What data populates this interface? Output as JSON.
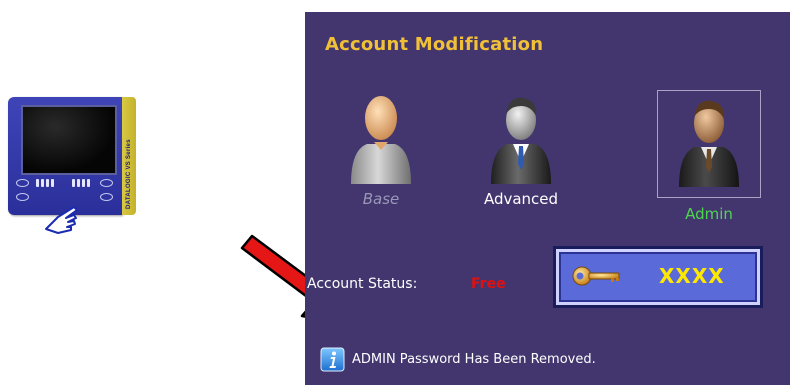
{
  "device": {
    "icon": "scanner-device-icon",
    "brand_text": "DATALOGIC VS Series",
    "hand_icon": "pointing-hand-icon"
  },
  "arrow": {
    "icon": "red-arrow-icon",
    "color": "#e41616"
  },
  "panel": {
    "title": "Account Modification",
    "background": "#43366f",
    "accounts": [
      {
        "label": "Base",
        "icon": "user-base-icon",
        "state": "disabled"
      },
      {
        "label": "Advanced",
        "icon": "user-advanced-icon",
        "state": "normal"
      },
      {
        "label": "Admin",
        "icon": "user-admin-icon",
        "state": "selected"
      }
    ],
    "status": {
      "label": "Account Status:",
      "value": "Free",
      "value_color": "#e01010"
    },
    "password_button": {
      "icon": "key-icon",
      "text": "XXXX",
      "text_color": "#ffe800"
    },
    "info": {
      "icon": "info-icon",
      "message": "ADMIN Password Has Been Removed."
    }
  }
}
